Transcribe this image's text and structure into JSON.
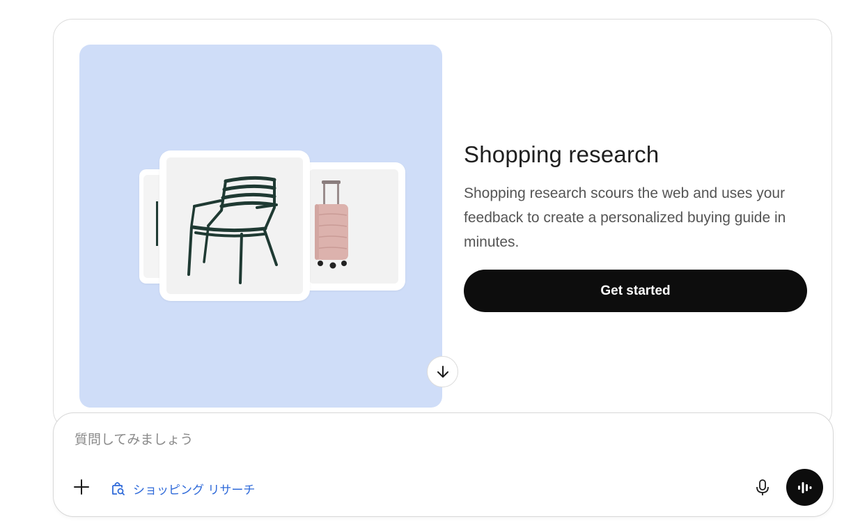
{
  "promo": {
    "title": "Shopping research",
    "description": "Shopping research scours the web and uses your feedback to create a personalized buying guide in minutes.",
    "cta_label": "Get started",
    "hero_bg": "#cfddf8",
    "products": [
      "chair",
      "suitcase"
    ]
  },
  "composer": {
    "placeholder": "質問してみましょう",
    "value": "",
    "tool_chip_label": "ショッピング リサーチ",
    "tool_chip_color": "#2f6ad9",
    "add_icon": "plus-icon",
    "mic_icon": "microphone-icon",
    "voice_icon": "voice-waveform-icon"
  },
  "scroll_button_icon": "arrow-down-icon"
}
